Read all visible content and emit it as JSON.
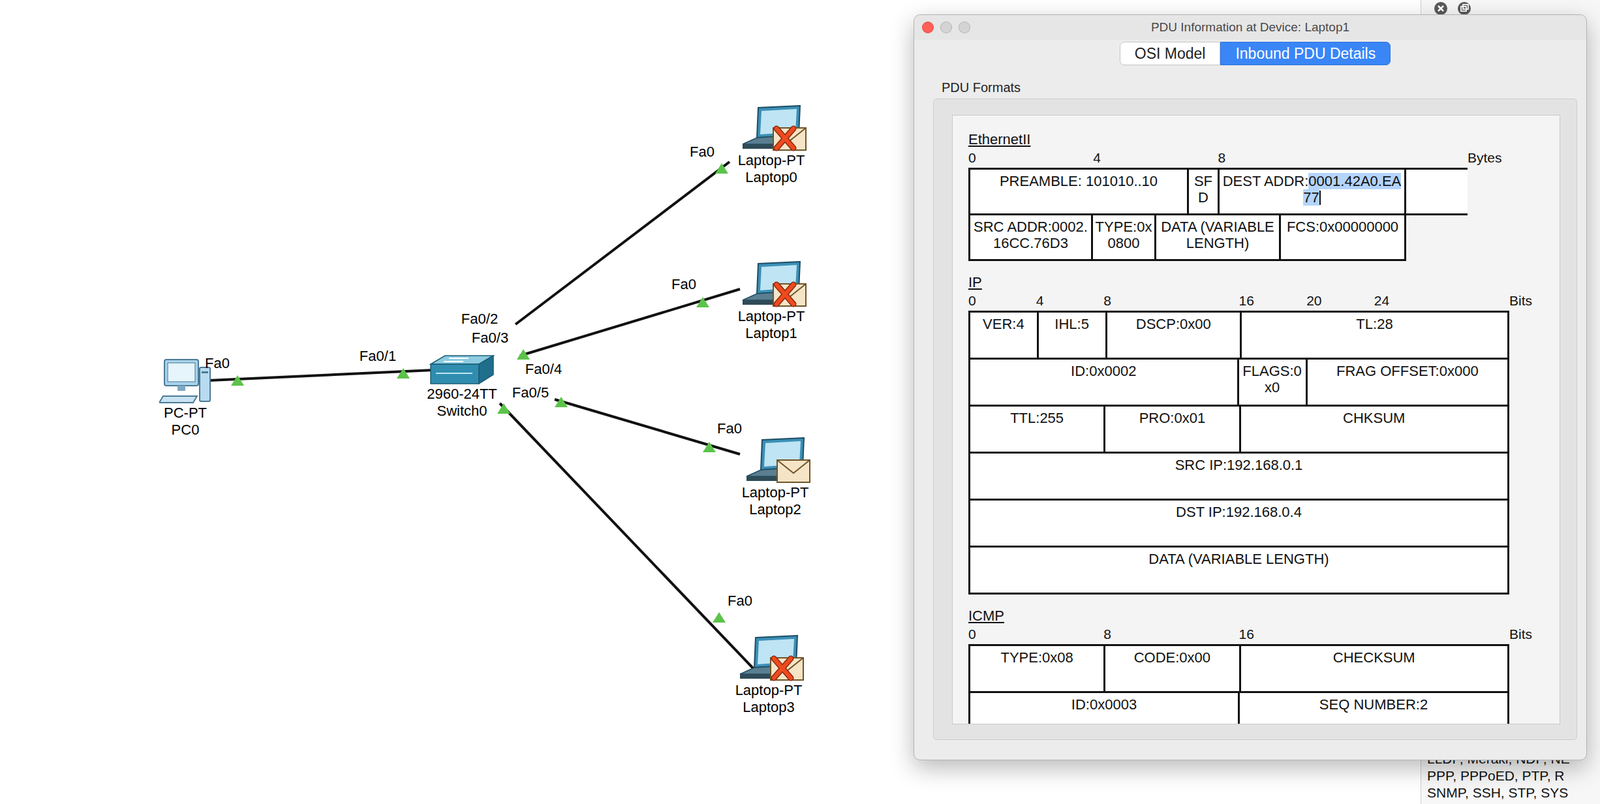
{
  "canvas": {
    "devices": [
      {
        "kind": "pc",
        "model": "PC-PT",
        "name": "PC0",
        "pdu": false,
        "failed": false
      },
      {
        "kind": "switch",
        "model": "2960-24TT",
        "name": "Switch0",
        "pdu": false,
        "failed": false
      },
      {
        "kind": "laptop",
        "model": "Laptop-PT",
        "name": "Laptop0",
        "pdu": true,
        "failed": true
      },
      {
        "kind": "laptop",
        "model": "Laptop-PT",
        "name": "Laptop1",
        "pdu": true,
        "failed": true
      },
      {
        "kind": "laptop",
        "model": "Laptop-PT",
        "name": "Laptop2",
        "pdu": true,
        "failed": false
      },
      {
        "kind": "laptop",
        "model": "Laptop-PT",
        "name": "Laptop3",
        "pdu": true,
        "failed": true
      }
    ],
    "links": [
      {
        "ports": [
          "Fa0",
          "Fa0/1"
        ],
        "up": true
      },
      {
        "ports": [
          "Fa0/2",
          "Fa0"
        ],
        "up": true
      },
      {
        "ports": [
          "Fa0/3",
          "Fa0"
        ],
        "up": true
      },
      {
        "ports": [
          "Fa0/4",
          "Fa0"
        ],
        "up": true
      },
      {
        "ports": [
          "Fa0/5",
          "Fa0"
        ],
        "up": true
      }
    ]
  },
  "pdu_window": {
    "title": "PDU Information at Device: Laptop1",
    "tabs": [
      {
        "label": "OSI Model",
        "selected": false
      },
      {
        "label": "Inbound PDU Details",
        "selected": true
      }
    ],
    "section_title": "PDU Formats",
    "formats": [
      {
        "name": "EthernetII",
        "scale": [
          "0",
          "4",
          "8"
        ],
        "unit": "Bytes",
        "rows": [
          [
            {
              "label": "PREAMBLE: 101010..10"
            },
            {
              "label": "SFD"
            },
            {
              "label": "DEST ADDR:",
              "value": "0001.42A0.EA77",
              "value_selected": true
            },
            {
              "label": ""
            }
          ],
          [
            {
              "label": "SRC ADDR:0002.16CC.76D3"
            },
            {
              "label": "TYPE:0x0800"
            },
            {
              "label": "DATA (VARIABLE LENGTH)"
            },
            {
              "label": "FCS:0x00000000"
            }
          ]
        ]
      },
      {
        "name": "IP",
        "scale": [
          "0",
          "4",
          "8",
          "16",
          "20",
          "24"
        ],
        "unit": "Bits",
        "rows": [
          [
            {
              "label": "VER:4"
            },
            {
              "label": "IHL:5"
            },
            {
              "label": "DSCP:0x00"
            },
            {
              "label": "TL:28"
            }
          ],
          [
            {
              "label": "ID:0x0002"
            },
            {
              "label": "FLAGS:0x0"
            },
            {
              "label": "FRAG OFFSET:0x000"
            }
          ],
          [
            {
              "label": "TTL:255"
            },
            {
              "label": "PRO:0x01"
            },
            {
              "label": "CHKSUM"
            }
          ],
          [
            {
              "label": "SRC IP:192.168.0.1"
            }
          ],
          [
            {
              "label": "DST IP:192.168.0.4"
            }
          ],
          [
            {
              "label": "DATA (VARIABLE LENGTH)"
            }
          ]
        ]
      },
      {
        "name": "ICMP",
        "scale": [
          "0",
          "8",
          "16"
        ],
        "unit": "Bits",
        "rows": [
          [
            {
              "label": "TYPE:0x08"
            },
            {
              "label": "CODE:0x00"
            },
            {
              "label": "CHECKSUM"
            }
          ],
          [
            {
              "label": "ID:0x0003"
            },
            {
              "label": "SEQ NUMBER:2"
            }
          ]
        ]
      }
    ]
  },
  "side_panel": {
    "lines": [
      "LLDP, Meraki, NDP, NE",
      "PPP, PPPoED, PTP, R",
      "SNMP, SSH, STP, SYS"
    ]
  }
}
